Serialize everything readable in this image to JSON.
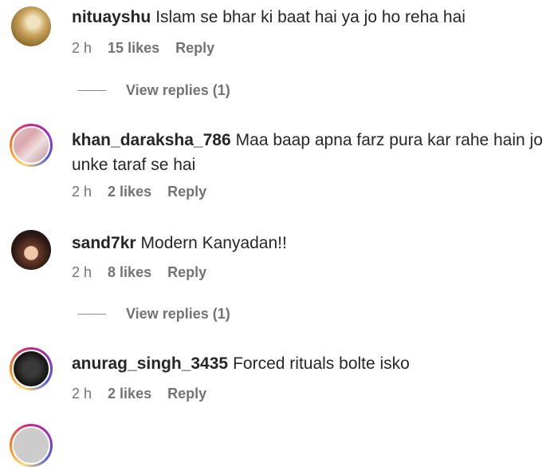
{
  "comments": [
    {
      "username": "nituayshu",
      "text": "Islam se bhar ki baat hai ya jo ho reha hai",
      "time": "2 h",
      "likes": "15 likes",
      "reply": "Reply",
      "view_replies": "View replies (1)"
    },
    {
      "username": "khan_daraksha_786",
      "text": "Maa baap apna farz pura kar rahe hain jo unke taraf se hai",
      "time": "2 h",
      "likes": "2 likes",
      "reply": "Reply"
    },
    {
      "username": "sand7kr",
      "text": "Modern Kanyadan!!",
      "time": "2 h",
      "likes": "8 likes",
      "reply": "Reply",
      "view_replies": "View replies (1)"
    },
    {
      "username": "anurag_singh_3435",
      "text": "Forced rituals bolte isko",
      "time": "2 h",
      "likes": "2 likes",
      "reply": "Reply"
    }
  ],
  "colors": {
    "text": "#262626",
    "secondary": "#737373",
    "story_ring": [
      "#feda75",
      "#fa7e1e",
      "#d62976",
      "#962fbf",
      "#4f5bd5"
    ]
  }
}
